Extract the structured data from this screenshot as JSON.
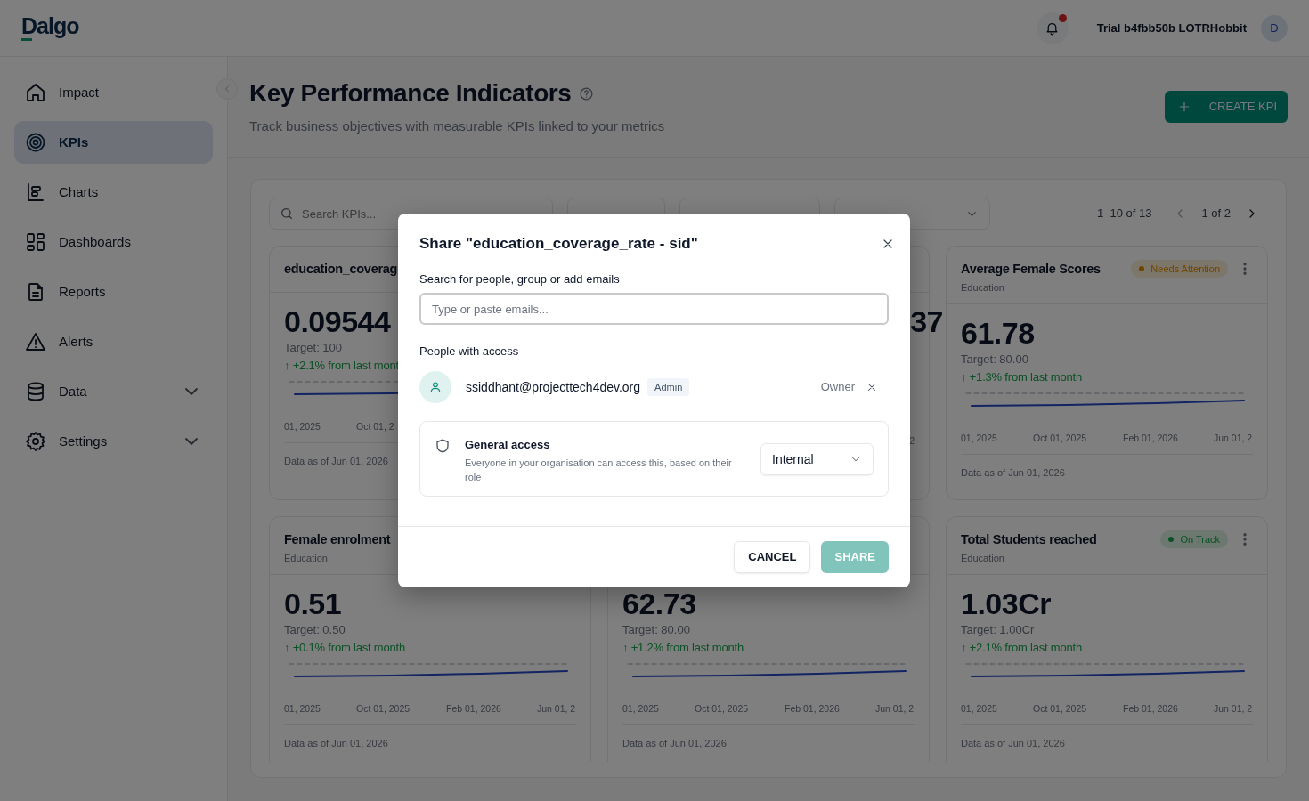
{
  "header": {
    "logo": "Dalgo",
    "notification_unread": true,
    "org": "Trial b4fbb50b LOTRHobbit",
    "avatar": "D"
  },
  "sidebar": {
    "items": [
      {
        "label": "Impact",
        "selected": false,
        "has_submenu": false
      },
      {
        "label": "KPIs",
        "selected": true,
        "has_submenu": false
      },
      {
        "label": "Charts",
        "selected": false,
        "has_submenu": false
      },
      {
        "label": "Dashboards",
        "selected": false,
        "has_submenu": false
      },
      {
        "label": "Reports",
        "selected": false,
        "has_submenu": false
      },
      {
        "label": "Alerts",
        "selected": false,
        "has_submenu": false
      },
      {
        "label": "Data",
        "selected": false,
        "has_submenu": true
      },
      {
        "label": "Settings",
        "selected": false,
        "has_submenu": true
      }
    ]
  },
  "page": {
    "title": "Key Performance Indicators",
    "subtitle": "Track business objectives with measurable KPIs linked to your metrics",
    "create_button": "CREATE KPI"
  },
  "filters": {
    "search_placeholder": "Search KPIs...",
    "dropdowns": [
      {
        "kind": "covered"
      },
      {
        "kind": "covered"
      },
      {
        "kind": "chevron"
      }
    ],
    "range": "1–10 of 13",
    "page": "1 of 2",
    "prev_enabled": false,
    "next_enabled": true
  },
  "cards": [
    {
      "kind": "full",
      "title": "education_coverag",
      "value": "0.09544",
      "target": "Target: 100",
      "change": "↑ +2.1% from last mont",
      "axis": [
        "01, 2025",
        "Oct 01, 2"
      ],
      "footer": "Data as of Jun 01, 2026"
    },
    {
      "kind": "covered",
      "value": "37",
      "axis": [
        "2"
      ]
    },
    {
      "kind": "full",
      "title": "Average Female Scores",
      "subtitle": "Education",
      "status": {
        "label": "Needs Attention",
        "color": "#704500"
      },
      "value": "61.78",
      "target": "Target: 80.00",
      "change": "↑ +1.3% from last month",
      "axis": [
        "01, 2025",
        "Oct 01, 2025",
        "Feb 01, 2026",
        "Jun 01, 2"
      ],
      "footer": "Data as of Jun 01, 2026"
    },
    {
      "kind": "full",
      "title": "Female enrolment",
      "subtitle": "Education",
      "value": "0.51",
      "target": "Target: 0.50",
      "change": "↑ +0.1% from last month",
      "axis": [
        "01, 2025",
        "Oct 01, 2025",
        "Feb 01, 2026",
        "Jun 01, 2"
      ],
      "footer": "Data as of Jun 01, 2026"
    },
    {
      "kind": "body_only",
      "value": "62.73",
      "target": "Target: 80.00",
      "change": "↑ +1.2% from last month",
      "axis": [
        "01, 2025",
        "Oct 01, 2025",
        "Feb 01, 2026",
        "Jun 01, 2"
      ],
      "footer": "Data as of Jun 01, 2026"
    },
    {
      "kind": "full",
      "title": "Total Students reached",
      "subtitle": "Education",
      "status": {
        "label": "On Track",
        "color": "#0b5125"
      },
      "value": "1.03Cr",
      "target": "Target: 1.00Cr",
      "change": "↑ +2.1% from last month",
      "axis": [
        "01, 2025",
        "Oct 01, 2025",
        "Feb 01, 2026",
        "Jun 01, 2"
      ],
      "footer": "Data as of Jun 01, 2026"
    }
  ],
  "dialog": {
    "title": "Share \"education_coverage_rate - sid\"",
    "search_label": "Search for people, group or add emails",
    "search_placeholder": "Type or paste emails...",
    "people_label": "People with access",
    "people": [
      {
        "email": "ssiddhant@projecttech4dev.org",
        "role": "Admin",
        "access": "Owner",
        "removable": true
      }
    ],
    "general_access": {
      "title": "General access",
      "description": "Everyone in your organisation can access this, based on their role",
      "option": "Internal"
    },
    "cancel": "CANCEL",
    "share": {
      "label": "SHARE",
      "disabled": true
    }
  }
}
